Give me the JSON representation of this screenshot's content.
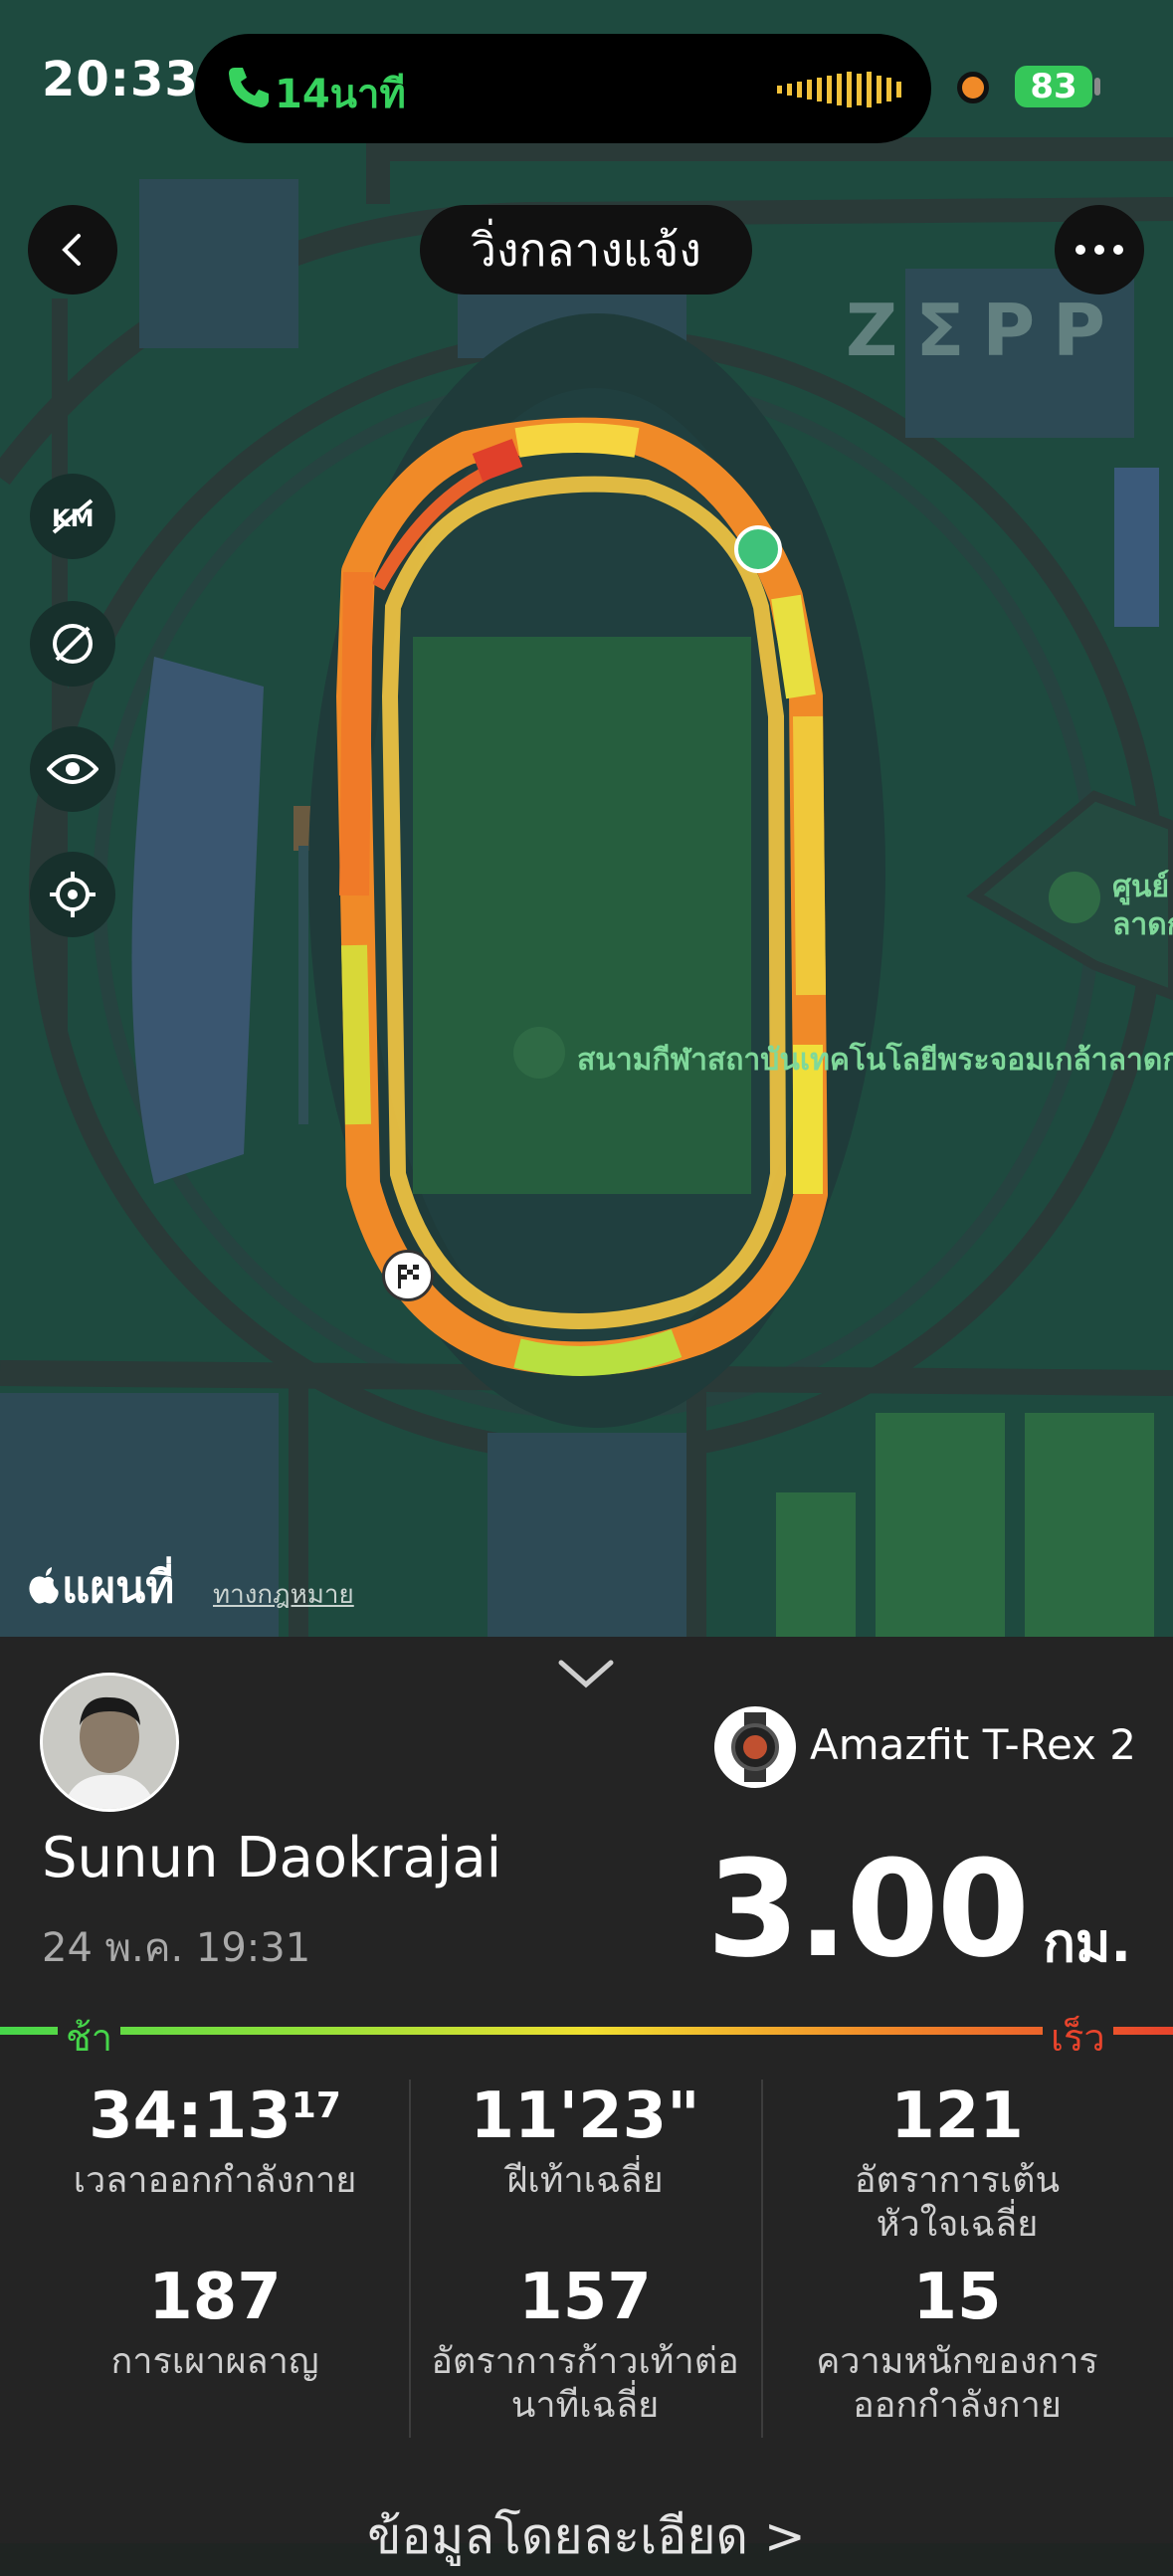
{
  "status_bar": {
    "time": "20:33",
    "call_duration": "14นาที",
    "battery": "83"
  },
  "header": {
    "title": "วิ่งกลางแจ้ง",
    "watermark": "ZΣPP"
  },
  "map": {
    "poi_stadium": "สนามกีฬาสถาบันเทคโนโลยีพระจอมเกล้าลาดก",
    "poi_center_line1": "ศูนย์",
    "poi_center_line2": "ลาดก",
    "maps_brand": "แผนที่",
    "legal_link": "ทางกฎหมาย"
  },
  "summary": {
    "device": "Amazfit T-Rex 2",
    "user_name": "Sunun Daokrajai",
    "date": "24 พ.ค. 19:31",
    "distance": "3.00",
    "distance_unit": "กม."
  },
  "pace_scale": {
    "slow": "ช้า",
    "fast": "เร็ว"
  },
  "stats": {
    "duration_main": "34:13",
    "duration_frac": "17",
    "duration_label": "เวลาออกกำลังกาย",
    "pace_value": "11'23\"",
    "pace_label": "ฝีเท้าเฉลี่ย",
    "hr_value": "121",
    "hr_label_1": "อัตราการเต้น",
    "hr_label_2": "หัวใจเฉลี่ย",
    "calories_value": "187",
    "calories_label": "การเผาผลาญ",
    "cadence_value": "157",
    "cadence_label_1": "อัตราการก้าวเท้าต่อ",
    "cadence_label_2": "นาทีเฉลี่ย",
    "load_value": "15",
    "load_label_1": "ความหนักของการ",
    "load_label_2": "ออกกำลังกาย"
  },
  "footer": {
    "details_link": "ข้อมูลโดยละเอียด >"
  }
}
